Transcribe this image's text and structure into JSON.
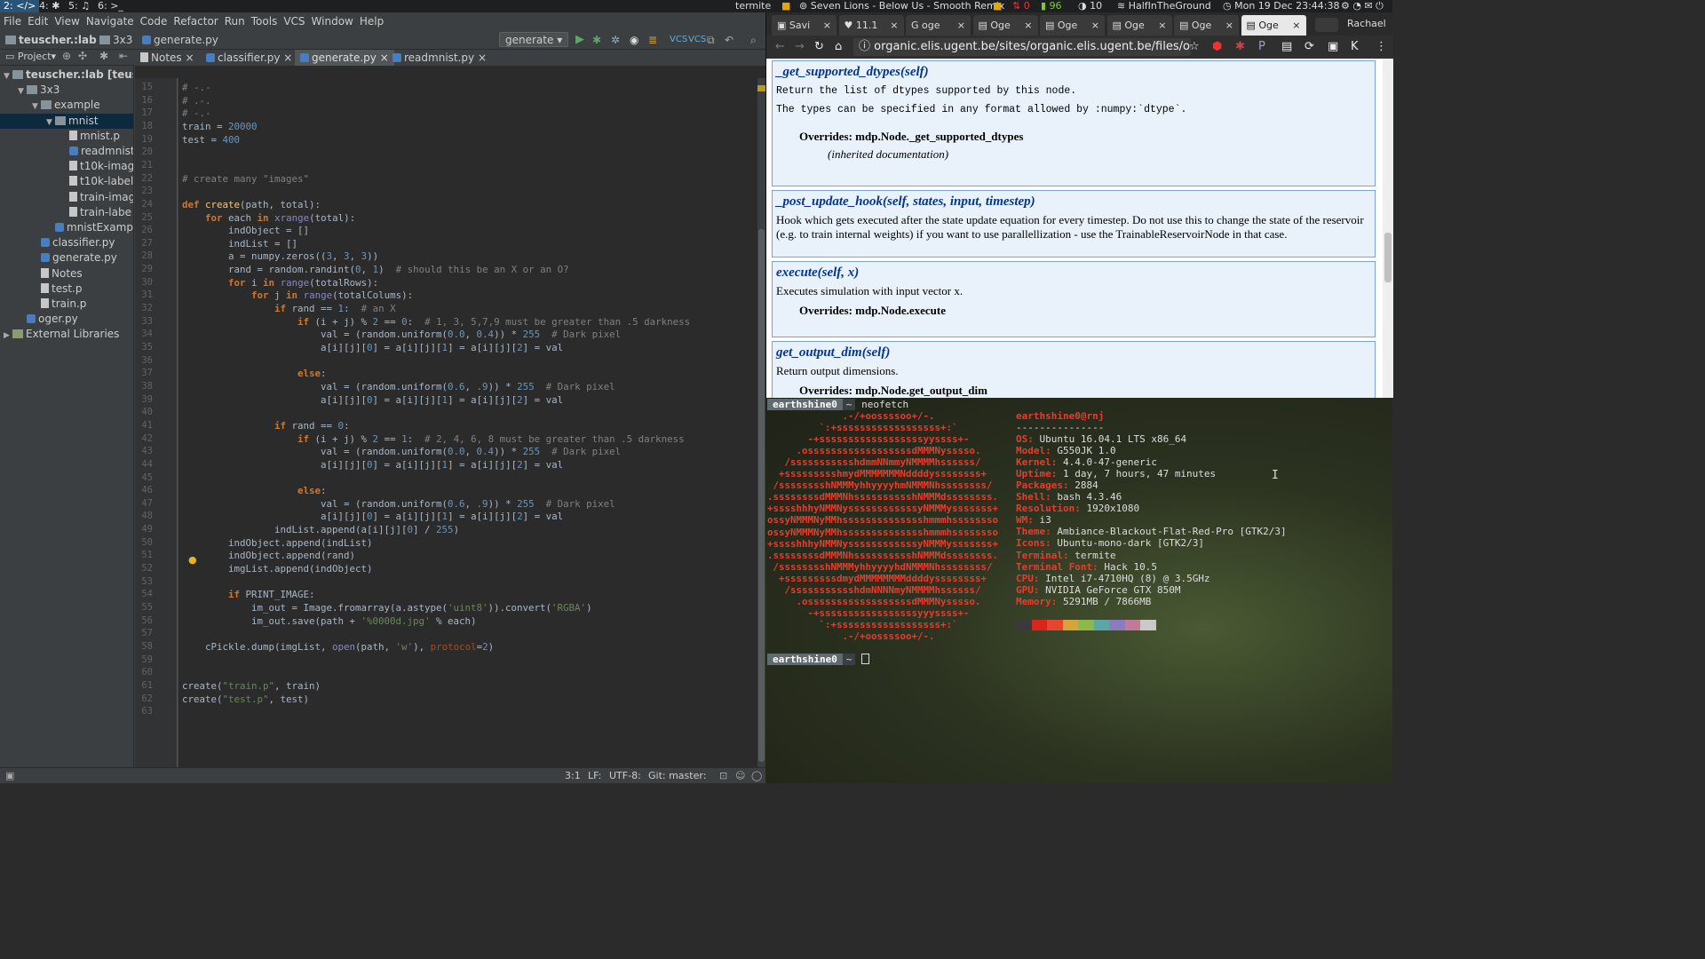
{
  "topbar": {
    "workspaces": [
      "2: </>",
      "4: ✱",
      "5: ♫",
      "6: >_"
    ],
    "active_title": "termite",
    "music": "Seven Lions - Below Us - Smooth Remix",
    "net_down": "0",
    "battery": "96",
    "brightness": "10",
    "wifi": "HalfInTheGround",
    "datetime": "Mon 19 Dec 23:44:38",
    "user": "Rachael"
  },
  "ide": {
    "menu": [
      "File",
      "Edit",
      "View",
      "Navigate",
      "Code",
      "Refactor",
      "Run",
      "Tools",
      "VCS",
      "Window",
      "Help"
    ],
    "breadcrumb": [
      "teuscher.:lab",
      "3x3",
      "generate.py"
    ],
    "run_config": "generate",
    "project_label": "Project",
    "tabs": [
      "Notes",
      "classifier.py",
      "generate.py",
      "readmnist.py"
    ],
    "tree": [
      {
        "label": "teuscher.:lab [teusch",
        "depth": 0,
        "type": "folder",
        "open": true
      },
      {
        "label": "3x3",
        "depth": 1,
        "type": "folder",
        "open": true
      },
      {
        "label": "example",
        "depth": 2,
        "type": "folder",
        "open": true
      },
      {
        "label": "mnist",
        "depth": 3,
        "type": "folder",
        "open": true,
        "sel": true
      },
      {
        "label": "mnist.p",
        "depth": 4,
        "type": "file"
      },
      {
        "label": "readmnist",
        "depth": 4,
        "type": "py"
      },
      {
        "label": "t10k-imag",
        "depth": 4,
        "type": "file"
      },
      {
        "label": "t10k-label",
        "depth": 4,
        "type": "file"
      },
      {
        "label": "train-imag",
        "depth": 4,
        "type": "file"
      },
      {
        "label": "train-labe",
        "depth": 4,
        "type": "file"
      },
      {
        "label": "mnistExampl",
        "depth": 3,
        "type": "py"
      },
      {
        "label": "classifier.py",
        "depth": 2,
        "type": "py"
      },
      {
        "label": "generate.py",
        "depth": 2,
        "type": "py"
      },
      {
        "label": "Notes",
        "depth": 2,
        "type": "file"
      },
      {
        "label": "test.p",
        "depth": 2,
        "type": "file"
      },
      {
        "label": "train.p",
        "depth": 2,
        "type": "file"
      },
      {
        "label": "oger.py",
        "depth": 1,
        "type": "py"
      },
      {
        "label": "External Libraries",
        "depth": 0,
        "type": "lib",
        "open": false
      }
    ],
    "first_line": 15,
    "code": [
      "# -.-",
      "# .-.",
      "# -.-",
      "train = 20000",
      "test = 400",
      "",
      "",
      "# create many \"images\"",
      "",
      "def create(path, total):",
      "    for each in xrange(total):",
      "        indObject = []",
      "        indList = []",
      "        a = numpy.zeros((3, 3, 3))",
      "        rand = random.randint(0, 1)  # should this be an X or an O?",
      "        for i in range(totalRows):",
      "            for j in range(totalColums):",
      "                if rand == 1:  # an X",
      "                    if (i + j) % 2 == 0:  # 1, 3, 5,7,9 must be greater than .5 darkness",
      "                        val = (random.uniform(0.0, 0.4)) * 255  # Dark pixel",
      "                        a[i][j][0] = a[i][j][1] = a[i][j][2] = val",
      "",
      "                    else:",
      "                        val = (random.uniform(0.6, .9)) * 255  # Dark pixel",
      "                        a[i][j][0] = a[i][j][1] = a[i][j][2] = val",
      "",
      "                if rand == 0:",
      "                    if (i + j) % 2 == 1:  # 2, 4, 6, 8 must be greater than .5 darkness",
      "                        val = (random.uniform(0.0, 0.4)) * 255  # Dark pixel",
      "                        a[i][j][0] = a[i][j][1] = a[i][j][2] = val",
      "",
      "                    else:",
      "                        val = (random.uniform(0.6, .9)) * 255  # Dark pixel",
      "                        a[i][j][0] = a[i][j][1] = a[i][j][2] = val",
      "                indList.append(a[i][j][0] / 255)",
      "        indObject.append(indList)",
      "        indObject.append(rand)",
      "        imgList.append(indObject)",
      "",
      "        if PRINT_IMAGE:",
      "            im_out = Image.fromarray(a.astype('uint8')).convert('RGBA')",
      "            im_out.save(path + '%0000d.jpg' % each)",
      "",
      "    cPickle.dump(imgList, open(path, 'w'), protocol=2)",
      "",
      "",
      "create(\"train.p\", train)",
      "create(\"test.p\", test)",
      ""
    ],
    "status": {
      "pos": "3:1",
      "lf": "LF:",
      "enc": "UTF-8:",
      "git": "Git: master:"
    }
  },
  "browser": {
    "tabs": [
      "Savi",
      "11.1",
      "oge",
      "Oge",
      "Oge",
      "Oge",
      "Oge",
      "Oge"
    ],
    "url": "organic.elis.ugent.be/sites/organic.elis.ugent.be/files/oger-d",
    "entries": [
      {
        "name": "_get_supported_dtypes",
        "args": "(self)",
        "lines": [
          "Return the list of dtypes supported by this node.",
          "The types can be specified in any format allowed by :numpy:`dtype`."
        ],
        "mono": true,
        "override": "Overrides: mdp.Node._get_supported_dtypes",
        "inherited": "(inherited documentation)"
      },
      {
        "name": "_post_update_hook",
        "args": "(self, states, input, timestep)",
        "lines": [
          "Hook which gets executed after the state update equation for every timestep. Do not use this to change the state of the reservoir (e.g. to train internal weights) if you want to use parallellization - use the TrainableReservoirNode in that case."
        ],
        "mono": false,
        "override": "",
        "inherited": ""
      },
      {
        "name": "execute",
        "args": "(self, x)",
        "lines": [
          "Executes simulation with input vector x."
        ],
        "mono": false,
        "override": "Overrides: mdp.Node.execute",
        "inherited": ""
      },
      {
        "name": "get_output_dim",
        "args": "(self)",
        "lines": [
          "Return output dimensions."
        ],
        "mono": false,
        "override": "Overrides: mdp.Node.get_output_dim",
        "inherited": ""
      }
    ]
  },
  "terminal": {
    "prompt_user": "earthshine0",
    "prompt_dir": "~",
    "command": "neofetch",
    "logo": [
      "             .-/+oossssoo+/-.",
      "         `:+ssssssssssssssssss+:`",
      "       -+ssssssssssssssssssyyssss+-",
      "     .ossssssssssssssssssdMMMNysssso.",
      "   /ssssssssssshdmmNNmmyNMMMMhssssss/",
      "  +ssssssssshmydMMMMMMMNddddyssssssss+",
      " /sssssssshNMMMyhhyyyyhmNMMMNhssssssss/",
      ".ssssssssdMMMNhsssssssssshNMMMdssssssss.",
      "+sssshhhyNMMNyssssssssssssyNMMMysssssss+",
      "ossyNMMMNyMMhsssssssssssssshmmmhssssssso",
      "ossyNMMMNyMMhsssssssssssssshmmmhssssssso",
      "+sssshhhyNMMNyssssssssssssyNMMMysssssss+",
      ".ssssssssdMMMNhsssssssssshNMMMdssssssss.",
      " /sssssssshNMMMyhhyyyyhdNMMMNhssssssss/",
      "  +sssssssssdmydMMMMMMMMddddyssssssss+",
      "   /ssssssssssshdmNNNNmyNMMMMhssssss/",
      "     .ossssssssssssssssssdMMMNysssso.",
      "       -+sssssssssssssssssyyyssss+-",
      "         `:+ssssssssssssssssss+:`",
      "             .-/+oossssoo+/-."
    ],
    "header": "earthshine0@rnj",
    "separator": "---------------",
    "info": [
      {
        "k": "OS:",
        "v": "Ubuntu 16.04.1 LTS x86_64"
      },
      {
        "k": "Model:",
        "v": "G550JK 1.0"
      },
      {
        "k": "Kernel:",
        "v": "4.4.0-47-generic"
      },
      {
        "k": "Uptime:",
        "v": "1 day, 7 hours, 47 minutes"
      },
      {
        "k": "Packages:",
        "v": "2884"
      },
      {
        "k": "Shell:",
        "v": "bash 4.3.46"
      },
      {
        "k": "Resolution:",
        "v": "1920x1080"
      },
      {
        "k": "WM:",
        "v": "i3"
      },
      {
        "k": "Theme:",
        "v": "Ambiance-Blackout-Flat-Red-Pro [GTK2/3]"
      },
      {
        "k": "Icons:",
        "v": "Ubuntu-mono-dark [GTK2/3]"
      },
      {
        "k": "Terminal:",
        "v": "termite"
      },
      {
        "k": "Terminal Font:",
        "v": "Hack 10.5"
      },
      {
        "k": "CPU:",
        "v": "Intel i7-4710HQ (8) @ 3.5GHz"
      },
      {
        "k": "GPU:",
        "v": "NVIDIA GeForce GTX 850M"
      },
      {
        "k": "Memory:",
        "v": "5291MB / 7866MB"
      }
    ],
    "palette": [
      "#3a3a3a",
      "#d8261b",
      "#e6462d",
      "#d7a43b",
      "#8fb84c",
      "#5aa7a4",
      "#8c7bbd",
      "#c27a98",
      "#c9c9c9"
    ]
  }
}
